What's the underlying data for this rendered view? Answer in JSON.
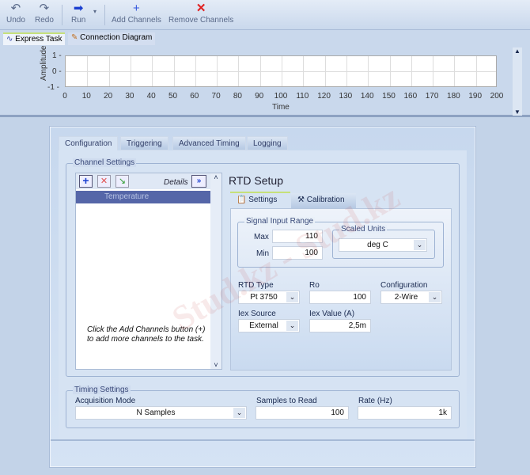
{
  "toolbar": {
    "undo": "Undo",
    "redo": "Redo",
    "run": "Run",
    "add_channels": "Add Channels",
    "remove_channels": "Remove Channels"
  },
  "view_tabs": {
    "express_task": "Express Task",
    "connection_diagram": "Connection Diagram"
  },
  "graph": {
    "ylabel": "Amplitude",
    "xlabel": "Time",
    "yticks": [
      "1",
      "0",
      "-1"
    ],
    "xticks": [
      "0",
      "10",
      "20",
      "30",
      "40",
      "50",
      "60",
      "70",
      "80",
      "90",
      "100",
      "110",
      "120",
      "130",
      "140",
      "150",
      "160",
      "170",
      "180",
      "190",
      "200"
    ]
  },
  "tabs": [
    "Configuration",
    "Triggering",
    "Advanced Timing",
    "Logging"
  ],
  "channel_settings": {
    "title": "Channel Settings",
    "details": "Details",
    "channels": [
      "Temperature"
    ],
    "hint": "Click the Add Channels button (+) to add more channels to the task."
  },
  "rtd": {
    "title": "RTD Setup",
    "tabs": [
      "Settings",
      "Calibration"
    ],
    "signal_range": {
      "title": "Signal Input Range",
      "max_label": "Max",
      "max": "110",
      "min_label": "Min",
      "min": "100"
    },
    "scaled_units": {
      "title": "Scaled Units",
      "value": "deg C"
    },
    "rtd_type_label": "RTD Type",
    "rtd_type": "Pt 3750",
    "ro_label": "Ro",
    "ro": "100",
    "configuration_label": "Configuration",
    "configuration": "2-Wire",
    "iex_source_label": "Iex Source",
    "iex_source": "External",
    "iex_value_label": "Iex Value (A)",
    "iex_value": "2,5m"
  },
  "timing": {
    "title": "Timing Settings",
    "mode_label": "Acquisition Mode",
    "mode": "N Samples",
    "samples_label": "Samples to Read",
    "samples": "100",
    "rate_label": "Rate (Hz)",
    "rate": "1k"
  },
  "watermark": "Stud.kz - Stud.kz",
  "colors": {
    "selected_row": "#5566a8",
    "run_arrow": "#1a3fd0",
    "remove_x": "#e02020"
  }
}
